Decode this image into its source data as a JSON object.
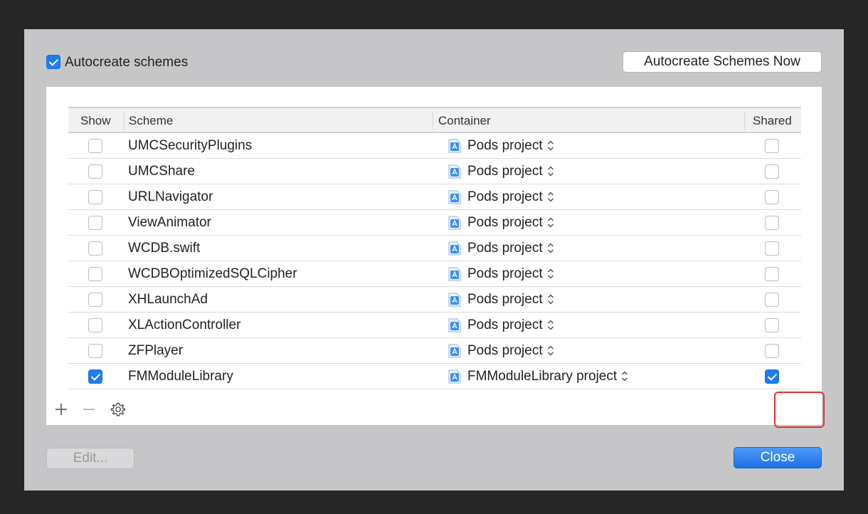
{
  "header": {
    "autocreate_label": "Autocreate schemes",
    "autocreate_checked": true,
    "autocreate_now_label": "Autocreate Schemes Now"
  },
  "table": {
    "columns": {
      "show": "Show",
      "scheme": "Scheme",
      "container": "Container",
      "shared": "Shared"
    },
    "rows": [
      {
        "show": false,
        "scheme": "UMCSecurityPlugins",
        "container": "Pods project",
        "shared": false
      },
      {
        "show": false,
        "scheme": "UMCShare",
        "container": "Pods project",
        "shared": false
      },
      {
        "show": false,
        "scheme": "URLNavigator",
        "container": "Pods project",
        "shared": false
      },
      {
        "show": false,
        "scheme": "ViewAnimator",
        "container": "Pods project",
        "shared": false
      },
      {
        "show": false,
        "scheme": "WCDB.swift",
        "container": "Pods project",
        "shared": false
      },
      {
        "show": false,
        "scheme": "WCDBOptimizedSQLCipher",
        "container": "Pods project",
        "shared": false
      },
      {
        "show": false,
        "scheme": "XHLaunchAd",
        "container": "Pods project",
        "shared": false
      },
      {
        "show": false,
        "scheme": "XLActionController",
        "container": "Pods project",
        "shared": false
      },
      {
        "show": false,
        "scheme": "ZFPlayer",
        "container": "Pods project",
        "shared": false
      },
      {
        "show": true,
        "scheme": "FMModuleLibrary",
        "container": "FMModuleLibrary project",
        "shared": true
      }
    ]
  },
  "footer": {
    "edit_label": "Edit...",
    "close_label": "Close"
  },
  "colors": {
    "accent": "#1e7cf2",
    "highlight": "#e33030"
  }
}
